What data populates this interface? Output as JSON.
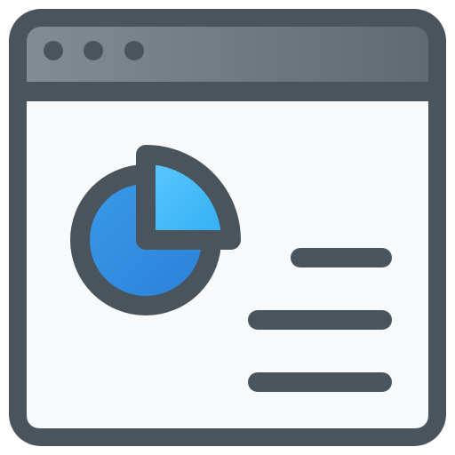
{
  "icon": {
    "name": "browser-window-pie-chart-icon",
    "window": {
      "title_dots": [
        "dot-1",
        "dot-2",
        "dot-3"
      ],
      "title_bar_gradient_start": "#818C95",
      "title_bar_gradient_end": "#5F6A73",
      "frame_color": "#4A545C",
      "content_background": "#F7F9FA"
    },
    "pie_chart": {
      "large_slice_color": "#2F8BE0",
      "small_slice_gradient_start": "#5FC8FF",
      "small_slice_gradient_end": "#2FAEF2",
      "outline_color": "#4A545C"
    },
    "text_lines": [
      "line-1",
      "line-2",
      "line-3"
    ],
    "colors": {
      "dark": "#4A545C"
    }
  }
}
